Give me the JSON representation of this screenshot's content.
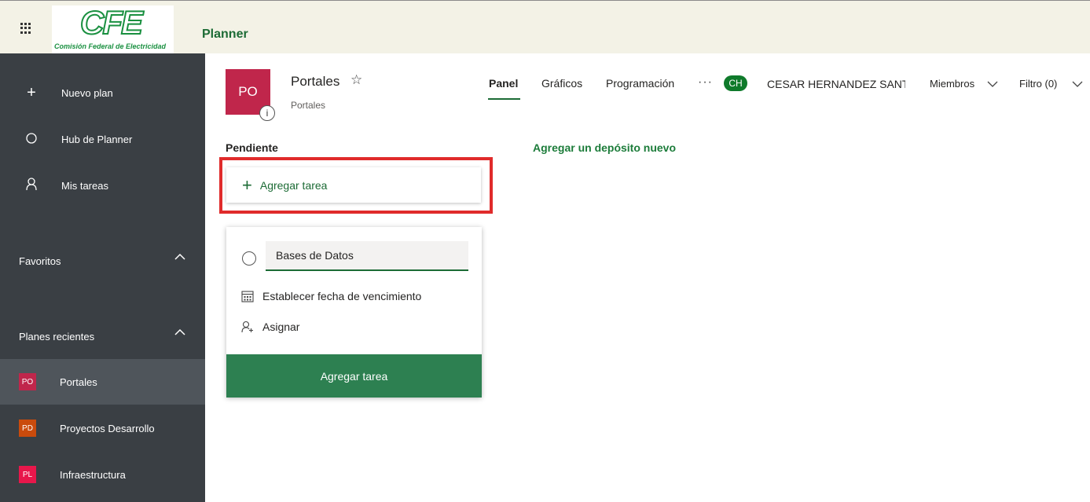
{
  "topbar": {
    "logo_text": "CFE",
    "logo_subtitle": "Comisión Federal de Electricidad",
    "app_title": "Planner"
  },
  "sidebar": {
    "nav": [
      {
        "label": "Nuevo plan",
        "icon": "plus-icon"
      },
      {
        "label": "Hub de Planner",
        "icon": "circle-icon"
      },
      {
        "label": "Mis tareas",
        "icon": "person-icon"
      }
    ],
    "favorites_label": "Favoritos",
    "recent_label": "Planes recientes",
    "recent_plans": [
      {
        "badge": "PO",
        "label": "Portales",
        "color": "#c0264b",
        "active": true
      },
      {
        "badge": "PD",
        "label": "Proyectos Desarrollo",
        "color": "#ca4b0c",
        "active": false
      },
      {
        "badge": "PL",
        "label": "Infraestructura",
        "color": "#e8174b",
        "active": false
      }
    ]
  },
  "plan": {
    "icon_text": "PO",
    "title": "Portales",
    "subtitle": "Portales",
    "info_badge": "i",
    "icon_color": "#c0264b"
  },
  "tabs": {
    "panel": "Panel",
    "graficos": "Gráficos",
    "programacion": "Programación",
    "more": "···"
  },
  "header": {
    "avatar_initials": "CH",
    "user_name": "CESAR HERNANDEZ SANTIAGO",
    "members_label": "Miembros",
    "filter_label": "Filtro (0)"
  },
  "board": {
    "bucket_title": "Pendiente",
    "new_bucket_label": "Agregar un depósito nuevo",
    "add_task_label": "Agregar tarea"
  },
  "task_card": {
    "name_value": "Bases de Datos",
    "due_date_label": "Establecer fecha de vencimiento",
    "assign_label": "Asignar",
    "submit_label": "Agregar tarea"
  },
  "colors": {
    "accent_green": "#1c6b35",
    "submit_green": "#2d8051",
    "highlight_red": "#e02b2b",
    "sidebar_bg": "#3a3f44"
  }
}
